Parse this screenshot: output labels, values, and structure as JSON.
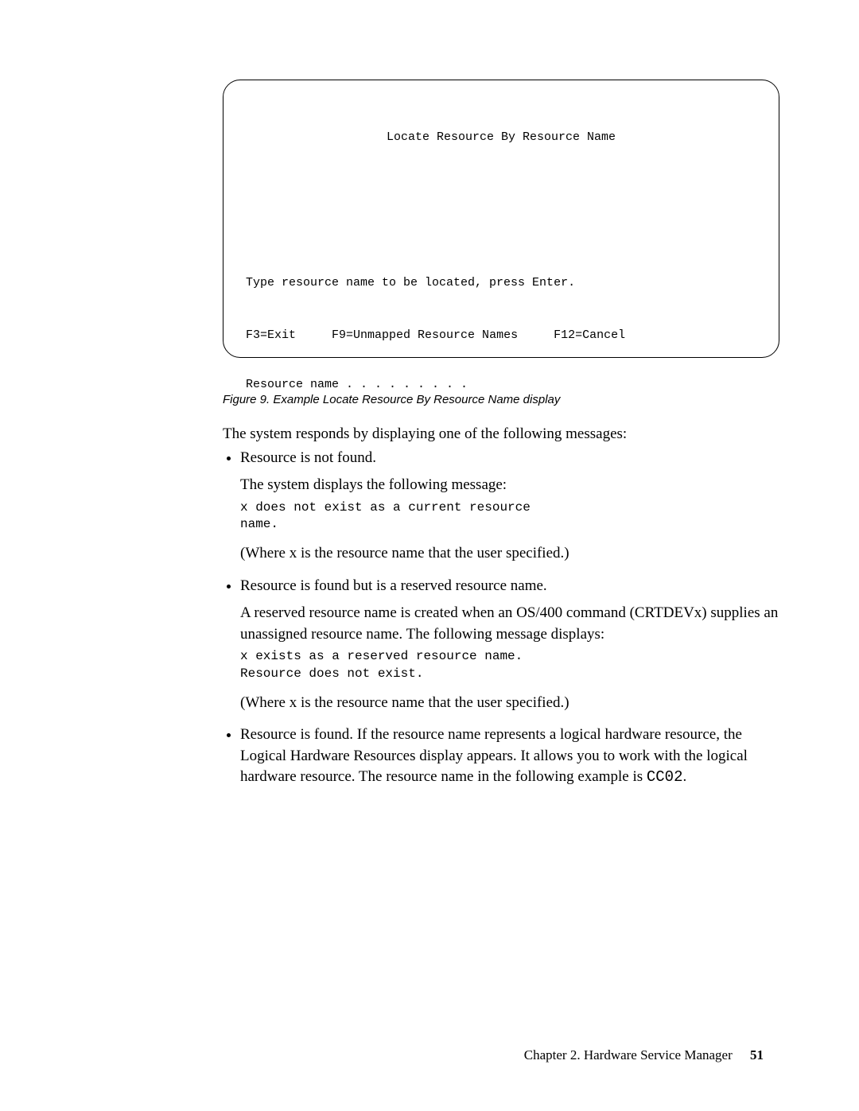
{
  "terminal": {
    "title": "Locate Resource By Resource Name",
    "instruction": "Type resource name to be located, press Enter.",
    "field_label": "Resource name . . . . . . . . .",
    "f3": "F3=Exit",
    "f9": "F9=Unmapped Resource Names",
    "f12": "F12=Cancel"
  },
  "caption": "Figure 9. Example Locate Resource By Resource Name display",
  "intro": "The system responds by displaying one of the following messages:",
  "bullets": {
    "b1": {
      "head": "Resource is not found.",
      "sub1": "The system displays the following message:",
      "code": "x does not exist as a current resource\nname.",
      "note": "(Where x is the resource name that the user specified.)"
    },
    "b2": {
      "head": "Resource is found but is a reserved resource name.",
      "sub1": "A reserved resource name is created when an OS/400 command (CRTDEVx) supplies an unassigned resource name. The following message displays:",
      "code": "x exists as a reserved resource name.\nResource does not exist.",
      "note": "(Where x is the resource name that the user specified.)"
    },
    "b3": {
      "text1": "Resource is found. If the resource name represents a logical hardware resource, the Logical Hardware Resources display appears. It allows you to work with the logical hardware resource. The resource name in the following example is ",
      "code_inline": "CC02",
      "text2": "."
    }
  },
  "footer": {
    "chapter": "Chapter 2. Hardware Service Manager",
    "page": "51"
  }
}
